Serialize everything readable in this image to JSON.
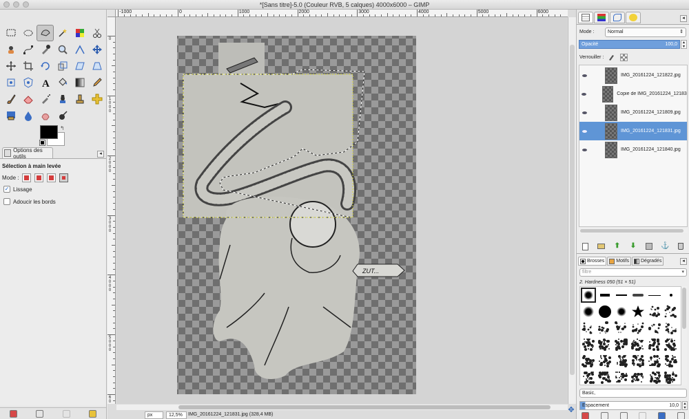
{
  "window": {
    "title": "*[Sans titre]-5.0 (Couleur RVB, 5 calques) 4000x6000 – GIMP"
  },
  "toolbox": {
    "tools": [
      "rect-select",
      "ellipse-select",
      "free-select",
      "fuzzy-select",
      "select-by-color",
      "scissors-select",
      "foreground-select",
      "paths",
      "color-picker",
      "zoom",
      "measure",
      "move",
      "align",
      "crop",
      "rotate",
      "scale",
      "shear",
      "perspective",
      "unified-transform",
      "cage-transform",
      "text",
      "bucket-fill",
      "blend",
      "pencil",
      "paintbrush",
      "eraser",
      "airbrush",
      "ink",
      "clone",
      "heal",
      "perspective-clone",
      "blur",
      "smudge",
      "dodge-burn"
    ],
    "active_tool_index": 2,
    "fg_color": "#000000",
    "bg_color": "#ffffff"
  },
  "tool_options": {
    "tab_label": "Options des outils",
    "heading": "Sélection à main levée",
    "mode_label": "Mode :",
    "mode_active_index": 3,
    "antialias_label": "Lissage",
    "antialias_checked": true,
    "feather_label": "Adoucir les bords",
    "feather_checked": false
  },
  "rulers": {
    "h_labels": [
      {
        "text": "-1000",
        "pos": -1000
      },
      {
        "text": "0",
        "pos": 0
      },
      {
        "text": "1000",
        "pos": 1000
      },
      {
        "text": "2000",
        "pos": 2000
      },
      {
        "text": "3000",
        "pos": 3000
      },
      {
        "text": "4000",
        "pos": 4000
      },
      {
        "text": "5000",
        "pos": 5000
      },
      {
        "text": "6000",
        "pos": 6000
      }
    ],
    "v_labels": [
      {
        "text": "0",
        "pos": 0
      },
      {
        "text": "1000",
        "pos": 1000
      },
      {
        "text": "2000",
        "pos": 2000
      },
      {
        "text": "3000",
        "pos": 3000
      },
      {
        "text": "4000",
        "pos": 4000
      },
      {
        "text": "5000",
        "pos": 5000
      },
      {
        "text": "6000",
        "pos": 6000
      }
    ]
  },
  "canvas": {
    "callout_text": "ZUT..."
  },
  "status": {
    "unit": "px",
    "zoom": "12,5%",
    "message": "IMG_20161224_121831.jpg (328,4 MB)"
  },
  "layers": {
    "mode_label": "Mode :",
    "mode_value": "Normal",
    "opacity_label": "Opacité",
    "opacity_value": "100,0",
    "lock_label": "Verrouiller :",
    "items": [
      {
        "name": "IMG_20161224_121822.jpg",
        "selected": false
      },
      {
        "name": "Copie de IMG_20161224_121831.jpg",
        "selected": false
      },
      {
        "name": "IMG_20161224_121809.jpg",
        "selected": false
      },
      {
        "name": "IMG_20161224_121831.jpg",
        "selected": true
      },
      {
        "name": "IMG_20161224_121840.jpg",
        "selected": false
      }
    ]
  },
  "brushes": {
    "tabs": [
      "Brosses",
      "Motifs",
      "Dégradés"
    ],
    "filter_placeholder": "filtre",
    "selected_brush": "2. Hardness 050 (51 × 51)",
    "preset": "Basic,",
    "spacing_label": "Espacement",
    "spacing_value": "10,0"
  },
  "colors": {
    "selection_blue": "#5f95d6",
    "accent_green": "#3a9c2e",
    "mode_red": "#d43c3c"
  }
}
